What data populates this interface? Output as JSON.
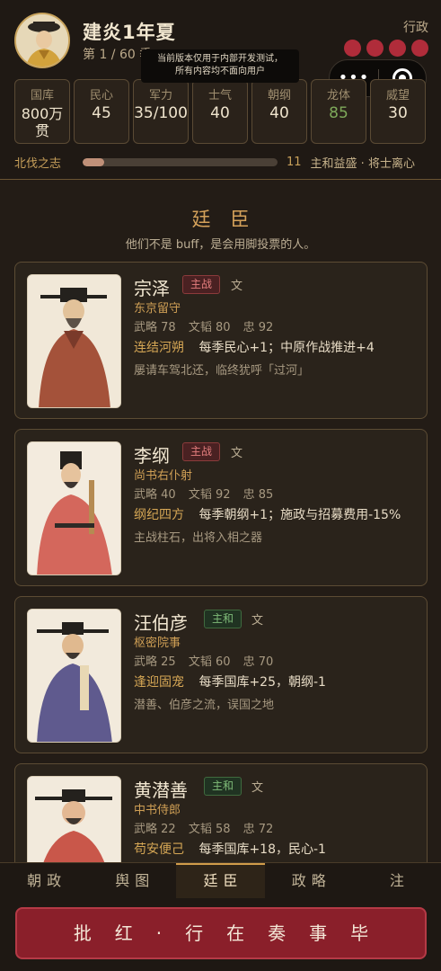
{
  "header": {
    "title": "建炎1年夏",
    "season": "第 1 / 60 季",
    "right_label": "行政",
    "tooltip_line1": "当前版本仅用于内部开发测试，",
    "tooltip_line2": "所有内容均不面向用户",
    "capsule_more": "•••",
    "stats": [
      {
        "label": "国库",
        "value": "800万贯"
      },
      {
        "label": "民心",
        "value": "45"
      },
      {
        "label": "军力",
        "value": "35/100"
      },
      {
        "label": "士气",
        "value": "40"
      },
      {
        "label": "朝纲",
        "value": "40"
      },
      {
        "label": "龙体",
        "value": "85"
      },
      {
        "label": "威望",
        "value": "30"
      }
    ],
    "progress": {
      "label": "北伐之志",
      "fill_fraction": 0.11,
      "count": "11",
      "status": "主和益盛 · 将士离心"
    }
  },
  "section": {
    "title": "廷臣",
    "subtitle": "他们不是 buff，是会用脚投票的人。"
  },
  "ministers": [
    {
      "name": "宗泽",
      "stance": "主战",
      "type": "文",
      "post": "东京留守",
      "wulue": "武略 78",
      "wentao": "文韬 80",
      "zhong": "忠 92",
      "trait_name": "连结河朔",
      "trait_effect": "每季民心+1；中原作战推进+4",
      "note": "屡请车驾北还，临终犹呼「过河」"
    },
    {
      "name": "李纲",
      "stance": "主战",
      "type": "文",
      "post": "尚书右仆射",
      "wulue": "武略 40",
      "wentao": "文韬 92",
      "zhong": "忠 85",
      "trait_name": "纲纪四方",
      "trait_effect": "每季朝纲+1；施政与招募费用-15%",
      "note": "主战柱石，出将入相之器"
    },
    {
      "name": "汪伯彦",
      "stance": "主和",
      "type": "文",
      "post": "枢密院事",
      "wulue": "武略 25",
      "wentao": "文韬 60",
      "zhong": "忠 70",
      "trait_name": "逢迎固宠",
      "trait_effect": "每季国库+25，朝纲-1",
      "note": "潜善、伯彦之流，误国之地"
    },
    {
      "name": "黄潜善",
      "stance": "主和",
      "type": "文",
      "post": "中书侍郎",
      "wulue": "武略 22",
      "wentao": "文韬 58",
      "zhong": "忠 72",
      "trait_name": "苟安便己",
      "trait_effect": "每季国库+18，民心-1",
      "note": ""
    }
  ],
  "tabs": [
    "朝政",
    "舆图",
    "廷臣",
    "政略",
    "注"
  ],
  "active_tab": "廷臣",
  "action_label": "批红·行在奏事毕",
  "colors": {
    "background": "#231c16",
    "accent_gold": "#d4a15a",
    "stance_war": "#e37d7d",
    "stance_peace": "#7fbb78",
    "action_red": "#8a1f2a"
  }
}
